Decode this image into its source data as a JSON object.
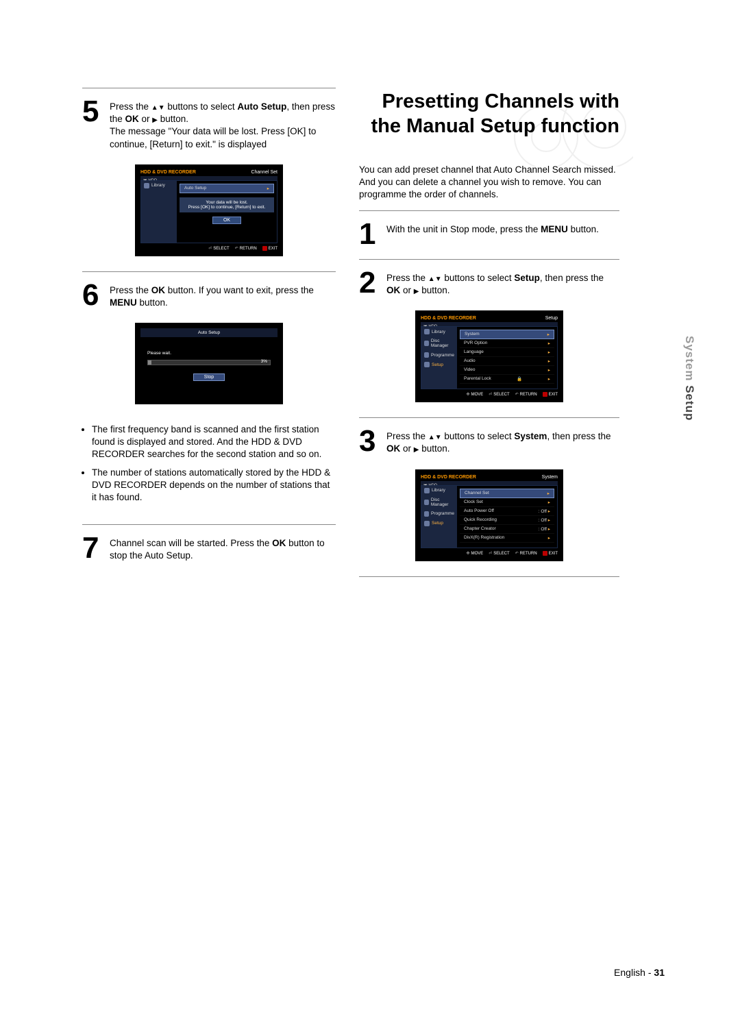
{
  "left": {
    "step5": {
      "num": "5",
      "line1_a": "Press the ",
      "line1_b": " buttons to select ",
      "line1_bold1": "Auto Setup",
      "line1_c": ", then press the ",
      "line1_bold2": "OK",
      "line1_d": " or ",
      "line1_e": " button.",
      "line2": "The message \"Your data will be lost. Press [OK] to continue, [Return] to exit.\" is displayed"
    },
    "osd1": {
      "brand": "HDD & DVD RECORDER",
      "topright": "Channel Set",
      "hdd": "HDD",
      "side": [
        "Library"
      ],
      "main_sel": "Auto Setup",
      "msg1": "Your data will be lost.",
      "msg2": "Press [OK] to continue, [Return] to exit.",
      "ok": "OK",
      "sel": "SELECT",
      "ret": "RETURN",
      "exit": "EXIT"
    },
    "step6": {
      "num": "6",
      "a": "Press the ",
      "b": "OK",
      "c": " button. If you want to exit, press the ",
      "d": "MENU",
      "e": " button."
    },
    "osd2": {
      "title": "Auto Setup",
      "wait": "Please wait.",
      "pct": "3%",
      "stop": "Stop"
    },
    "bullets": [
      "The first frequency band is scanned and the first station found is displayed and stored. And the HDD & DVD RECORDER searches for the second station and so on.",
      "The number of stations automatically stored by the HDD & DVD RECORDER depends on the number of stations that it has found."
    ],
    "step7": {
      "num": "7",
      "a": "Channel scan will be started. Press the ",
      "b": "OK",
      "c": " button to stop the Auto Setup."
    }
  },
  "right": {
    "title1": "Presetting Channels with",
    "title2": "the Manual Setup function",
    "intro": "You can add preset channel that Auto Channel Search missed. And you can delete a channel you wish to remove. You can programme the order of channels.",
    "step1": {
      "num": "1",
      "a": "With the unit in Stop mode, press the ",
      "b": "MENU",
      "c": " button."
    },
    "step2": {
      "num": "2",
      "a": "Press the ",
      "b": " buttons to select ",
      "c": "Setup",
      "d": ", then press the ",
      "e": "OK",
      "f": " or ",
      "g": " button."
    },
    "osd3": {
      "brand": "HDD & DVD RECORDER",
      "topright": "Setup",
      "hdd": "HDD",
      "side": [
        "Library",
        "Disc Manager",
        "Programme",
        "Setup"
      ],
      "rows": [
        "System",
        "PVR Option",
        "Language",
        "Audio",
        "Video",
        "Parental Lock"
      ],
      "move": "MOVE",
      "sel": "SELECT",
      "ret": "RETURN",
      "exit": "EXIT"
    },
    "step3": {
      "num": "3",
      "a": "Press the ",
      "b": " buttons to select ",
      "c": "System",
      "d": ", then press the ",
      "e": "OK",
      "f": " or ",
      "g": " button."
    },
    "osd4": {
      "brand": "HDD & DVD RECORDER",
      "topright": "System",
      "hdd": "HDD",
      "side": [
        "Library",
        "Disc Manager",
        "Programme",
        "Setup"
      ],
      "rows": [
        {
          "l": "Channel Set",
          "r": ""
        },
        {
          "l": "Clock Set",
          "r": ""
        },
        {
          "l": "Auto Power Off",
          "r": ": Off"
        },
        {
          "l": "Quick Recording",
          "r": ": Off"
        },
        {
          "l": "Chapter Creator",
          "r": ": Off"
        },
        {
          "l": "DivX(R) Registration",
          "r": ""
        }
      ],
      "move": "MOVE",
      "sel": "SELECT",
      "ret": "RETURN",
      "exit": "EXIT"
    }
  },
  "sideTab": {
    "a": "System ",
    "b": "Setup"
  },
  "footer": {
    "lang": "English",
    "sep": " - ",
    "page": "31"
  }
}
